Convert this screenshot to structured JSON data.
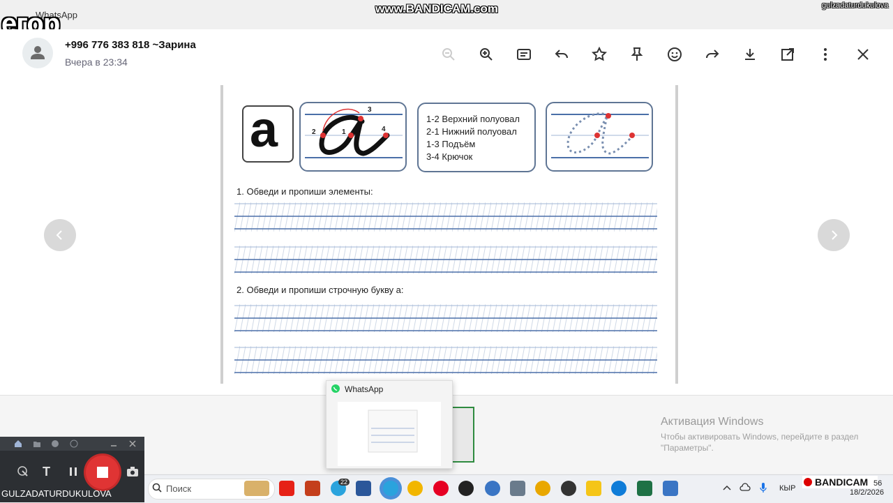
{
  "window": {
    "app_title": "WhatsApp",
    "overlay_name": "егор",
    "watermark": "www.BANDICAM.com",
    "user_watermark": "gulzadaturdukulova"
  },
  "header": {
    "contact_name": "+996 776 383 818 ~Зарина",
    "timestamp": "Вчера в 23:34",
    "tools": [
      "zoom-out-icon",
      "zoom-in-icon",
      "caption-icon",
      "reply-icon",
      "star-icon",
      "pin-icon",
      "emoji-icon",
      "forward-icon",
      "download-icon",
      "open-external-icon",
      "more-icon",
      "close-icon"
    ]
  },
  "worksheet": {
    "letter": "a",
    "legend": [
      "1-2 Верхний полуовал",
      "2-1 Нижний полуовал",
      "1-3 Подъём",
      "3-4 Крючок"
    ],
    "stroke_points": [
      "1",
      "2",
      "3",
      "4"
    ],
    "section1": "1. Обведи и пропиши элементы:",
    "section2": "2. Обведи и пропиши строчную букву  а:"
  },
  "activation": {
    "title": "Активация Windows",
    "text": "Чтобы активировать Windows, перейдите в раздел \"Параметры\"."
  },
  "preview": {
    "title": "WhatsApp"
  },
  "taskbar": {
    "search_placeholder": "Поиск",
    "telegram_badge": "22",
    "language": "КЫР",
    "date": "18/2/2026",
    "time": "56",
    "tray_brand": "BANDICAM"
  },
  "recorder": {
    "username": "GULZADATURDUKULOVA",
    "text_tool": "T"
  }
}
